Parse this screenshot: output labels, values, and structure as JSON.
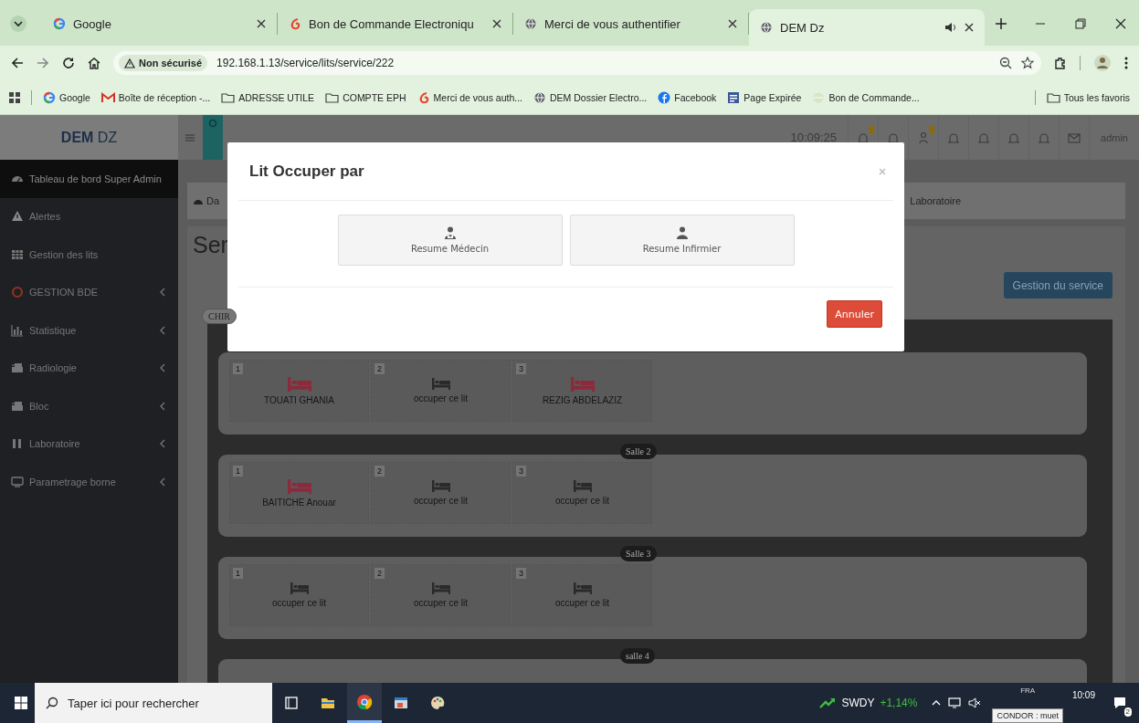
{
  "browser": {
    "tabs": [
      {
        "title": "Google",
        "kind": "google",
        "selected": false,
        "audio": false
      },
      {
        "title": "Bon de Commande Electroniqu",
        "kind": "brand",
        "selected": false,
        "audio": false
      },
      {
        "title": "Merci de vous authentifier",
        "kind": "globe",
        "selected": false,
        "audio": false
      },
      {
        "title": "DEM Dz",
        "kind": "globe",
        "selected": true,
        "audio": true
      }
    ],
    "security": "Non sécurisé",
    "url": "192.168.1.13/service/lits/service/222",
    "bookmarks": [
      {
        "label": "Google",
        "kind": "google"
      },
      {
        "label": "Boîte de réception -...",
        "kind": "mail"
      },
      {
        "label": "ADRESSE UTILE",
        "kind": "folder"
      },
      {
        "label": "COMPTE EPH",
        "kind": "folder"
      },
      {
        "label": "Merci de vous auth...",
        "kind": "brand"
      },
      {
        "label": "DEM Dossier Electro...",
        "kind": "globe"
      },
      {
        "label": "Facebook",
        "kind": "facebook"
      },
      {
        "label": "Page Expirée",
        "kind": "page"
      },
      {
        "label": "Bon de Commande...",
        "kind": "faded"
      }
    ],
    "all_bookmarks": "Tous les favoris"
  },
  "app": {
    "logo": "**DEM** DZ",
    "sidebar": {
      "items": [
        {
          "label": "Tableau de bord Super Admin",
          "kind": "gauge",
          "submenu": false,
          "selected": true
        },
        {
          "label": "Alertes",
          "kind": "warning",
          "submenu": false,
          "selected": false
        },
        {
          "label": "Gestion des lits",
          "kind": "grid",
          "submenu": false,
          "selected": false
        },
        {
          "label": "GESTION BDE",
          "kind": "circle",
          "submenu": true,
          "selected": false
        },
        {
          "label": "Statistique",
          "kind": "chart",
          "submenu": true,
          "selected": false
        },
        {
          "label": "Radiologie",
          "kind": "device",
          "submenu": true,
          "selected": false
        },
        {
          "label": "Bloc",
          "kind": "device",
          "submenu": true,
          "selected": false
        },
        {
          "label": "Laboratoire",
          "kind": "flask",
          "submenu": true,
          "selected": false
        },
        {
          "label": "Parametrage borne",
          "kind": "monitor",
          "submenu": true,
          "selected": false
        }
      ]
    },
    "header": {
      "time": "10:09:25",
      "icons": [
        {
          "kind": "bell",
          "badge": true
        },
        {
          "kind": "bell",
          "badge": false
        },
        {
          "kind": "person",
          "badge": true
        },
        {
          "kind": "bell",
          "badge": false
        },
        {
          "kind": "bell",
          "badge": false
        },
        {
          "kind": "bell",
          "badge": false
        },
        {
          "kind": "bell",
          "badge": false
        },
        {
          "kind": "mail",
          "badge": false
        }
      ],
      "user": "admin"
    },
    "breadcrumb": [
      "Da",
      "Laboratoire"
    ],
    "title": "Ser",
    "action_button": "Gestion du service",
    "service_tag": "CHIR",
    "rooms": [
      {
        "beds": [
          {
            "number": "1",
            "occupied": true,
            "text": "TOUATI GHANIA"
          },
          {
            "number": "2",
            "occupied": false,
            "text": "occuper ce lit"
          },
          {
            "number": "3",
            "occupied": true,
            "text": "REZIG ABDELAZIZ"
          }
        ]
      },
      {
        "label": "Salle 2",
        "beds": [
          {
            "number": "1",
            "occupied": true,
            "text": "BAITICHE Anouar"
          },
          {
            "number": "2",
            "occupied": false,
            "text": "occuper ce lit"
          },
          {
            "number": "3",
            "occupied": false,
            "text": "occuper ce lit"
          }
        ]
      },
      {
        "label": "Salle 3",
        "beds": [
          {
            "number": "1",
            "occupied": false,
            "text": "occuper ce lit"
          },
          {
            "number": "2",
            "occupied": false,
            "text": "occuper ce lit"
          },
          {
            "number": "3",
            "occupied": false,
            "text": "occuper ce lit"
          }
        ]
      },
      {
        "label": "salle 4"
      }
    ]
  },
  "modal": {
    "title": "Lit Occuper par",
    "buttons": [
      {
        "label": "Resume Médecin",
        "kind": "doctor"
      },
      {
        "label": "Resume Infirmier",
        "kind": "person"
      }
    ],
    "cancel": "Annuler"
  },
  "taskbar": {
    "search_placeholder": "Taper ici pour rechercher",
    "apps": [
      {
        "kind": "taskview",
        "active": false
      },
      {
        "kind": "folder",
        "active": false
      },
      {
        "kind": "chrome",
        "active": true
      },
      {
        "kind": "window",
        "active": false
      },
      {
        "kind": "paint",
        "active": false
      }
    ],
    "stock": {
      "symbol": "SWDY",
      "change": "+1,14%"
    },
    "language": "FRA",
    "tooltip": "CONDOR : muet",
    "time": "10:09",
    "notifications": "2"
  }
}
